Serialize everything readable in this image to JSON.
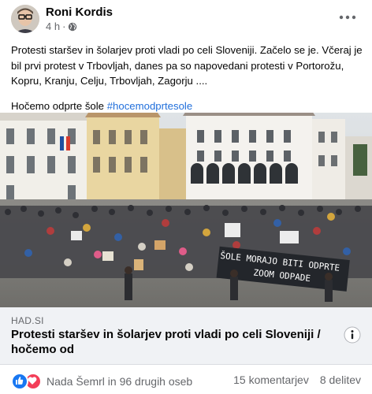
{
  "post": {
    "author": "Roni Kordis",
    "time": "4 h",
    "separator": "·",
    "paragraph1": "Protesti staršev in šolarjev proti vladi po celi Sloveniji. Začelo se je. Včeraj je bil prvi protest v Trbovljah, danes pa so napovedani protesti v Portorožu, Kopru, Kranju, Celju, Trbovljah, Zagorju ....",
    "paragraph2_text": "Hočemo odprte šole ",
    "hashtag": "#hocemodprtesole",
    "more_icon": "ellipsis-icon",
    "privacy_icon": "globe-icon"
  },
  "photo": {
    "banner_line1": "ŠOLE MORAJO BITI ODPRTE",
    "banner_line2": "ZOOM ODPADE"
  },
  "link": {
    "domain": "HAD.SI",
    "title": "Protesti staršev in šolarjev proti vladi po celi Sloveniji / hočemo od",
    "info_icon": "info-icon"
  },
  "footer": {
    "reactions_text": "Nada Šemrl in 96 drugih oseb",
    "comments": "15 komentarjev",
    "shares": "8 delitev"
  },
  "colors": {
    "hashtag": "#216fdb",
    "like": "#1877f2",
    "love": "#f33e58",
    "muted": "#65676b",
    "link_bg": "#f0f2f5"
  }
}
